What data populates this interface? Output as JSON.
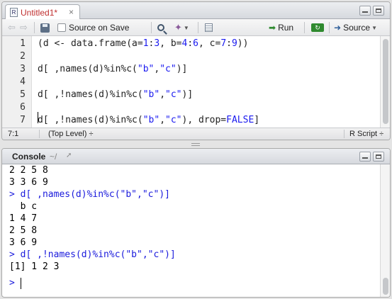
{
  "source": {
    "tab": {
      "title": "Untitled1*",
      "close": "×",
      "icon": "r-file-icon"
    },
    "toolbar": {
      "back_icon": "⇦",
      "forward_icon": "⇨",
      "source_on_save": "Source on Save",
      "run": "Run",
      "source": "Source",
      "icons": [
        "back-arrow-icon",
        "forward-arrow-icon",
        "save-icon",
        "search-icon",
        "code-tools-icon",
        "compile-notebook-icon",
        "run-icon",
        "rerun-icon",
        "source-icon"
      ]
    },
    "lines": [
      {
        "num": "1",
        "text": "(d <- data.frame(a=1:3, b=4:6, c=7:9))"
      },
      {
        "num": "2",
        "text": ""
      },
      {
        "num": "3",
        "text": "d[ ,names(d)%in%c(\"b\",\"c\")]"
      },
      {
        "num": "4",
        "text": ""
      },
      {
        "num": "5",
        "text": "d[ ,!names(d)%in%c(\"b\",\"c\")]"
      },
      {
        "num": "6",
        "text": ""
      },
      {
        "num": "7",
        "text": "d[ ,!names(d)%in%c(\"b\",\"c\"), drop=FALSE]"
      }
    ],
    "status": {
      "position": "7:1",
      "scope": "(Top Level) ÷",
      "filetype": "R Script ÷"
    }
  },
  "console": {
    "title": "Console",
    "dir": "~/",
    "lines": [
      {
        "text": "2 2 5 8",
        "type": "output"
      },
      {
        "text": "3 3 6 9",
        "type": "output"
      },
      {
        "text": "> d[ ,names(d)%in%c(\"b\",\"c\")]",
        "type": "cmd"
      },
      {
        "text": "  b c",
        "type": "output"
      },
      {
        "text": "1 4 7",
        "type": "output"
      },
      {
        "text": "2 5 8",
        "type": "output"
      },
      {
        "text": "3 6 9",
        "type": "output"
      },
      {
        "text": "> d[ ,!names(d)%in%c(\"b\",\"c\")]",
        "type": "cmd"
      },
      {
        "text": "[1] 1 2 3",
        "type": "output"
      },
      {
        "text": ">",
        "type": "cmd"
      }
    ]
  },
  "colors": {
    "keyword": "#1a1af0",
    "command": "#1a1adc",
    "tab_title": "#c03030",
    "run_green": "#2f8a2f"
  }
}
